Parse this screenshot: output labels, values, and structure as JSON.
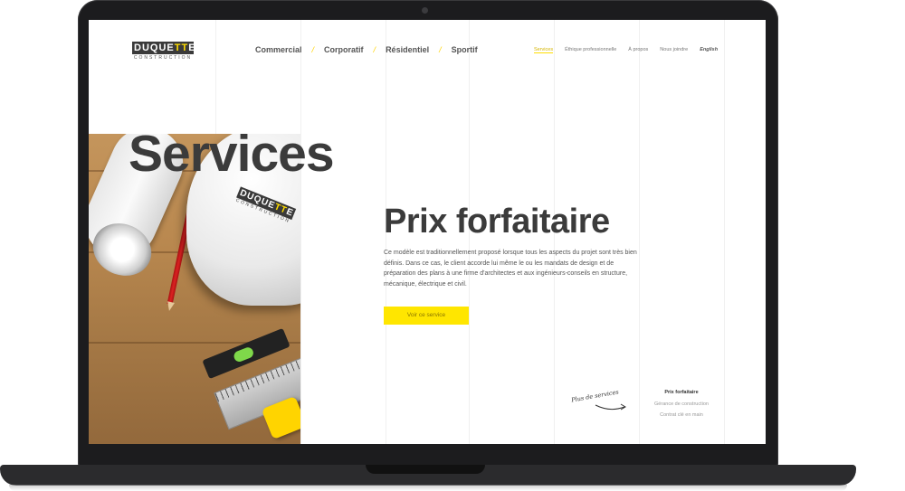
{
  "brand": {
    "logo_main_a": "DUQUE",
    "logo_main_b": "TT",
    "logo_main_c": "E",
    "logo_sub": "CONSTRUCTION"
  },
  "main_nav": {
    "items": [
      "Commercial",
      "Corporatif",
      "Résidentiel",
      "Sportif"
    ],
    "separator": "/"
  },
  "top_nav": {
    "items": [
      "Services",
      "Éthique professionnelle",
      "À propos",
      "Nous joindre"
    ],
    "active": "Services",
    "language": "English"
  },
  "hero": {
    "title": "Services"
  },
  "content": {
    "title": "Prix forfaitaire",
    "body": "Ce modèle est traditionnellement proposé lorsque tous les aspects du projet sont très bien définis. Dans ce cas, le client accorde lui même le ou les mandats de design et de préparation des plans à une firme d'architectes et aux ingénieurs-conseils en structure, mécanique, électrique et civil.",
    "button_label": "Voir ce service"
  },
  "more_services": {
    "label": "Plus de services",
    "items": [
      "Prix forfaitaire",
      "Gérance de construction",
      "Contrat clé en main"
    ],
    "current": "Prix forfaitaire"
  },
  "colors": {
    "accent": "#ffe600",
    "text_dark": "#3b3b3b",
    "laptop": "#1c1c1e"
  }
}
